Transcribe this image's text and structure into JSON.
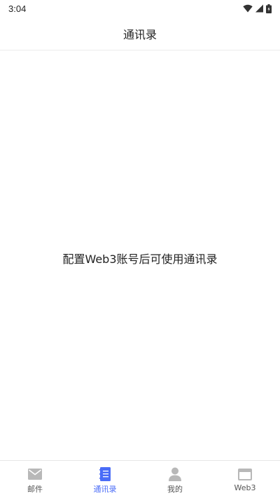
{
  "status_bar": {
    "time": "3:04",
    "icons": [
      "wifi-icon",
      "cellular-signal-icon",
      "battery-icon"
    ]
  },
  "header": {
    "title": "通讯录"
  },
  "main": {
    "empty_message": "配置Web3账号后可使用通讯录"
  },
  "bottom_nav": {
    "active_index": 1,
    "items": [
      {
        "label": "邮件",
        "icon": "mail-icon"
      },
      {
        "label": "通讯录",
        "icon": "address-book-icon"
      },
      {
        "label": "我的",
        "icon": "person-icon"
      },
      {
        "label": "Web3",
        "icon": "browser-window-icon"
      }
    ]
  },
  "colors": {
    "accent": "#4a6cf7",
    "inactive_icon": "#b8b8b8",
    "text": "#222222"
  }
}
